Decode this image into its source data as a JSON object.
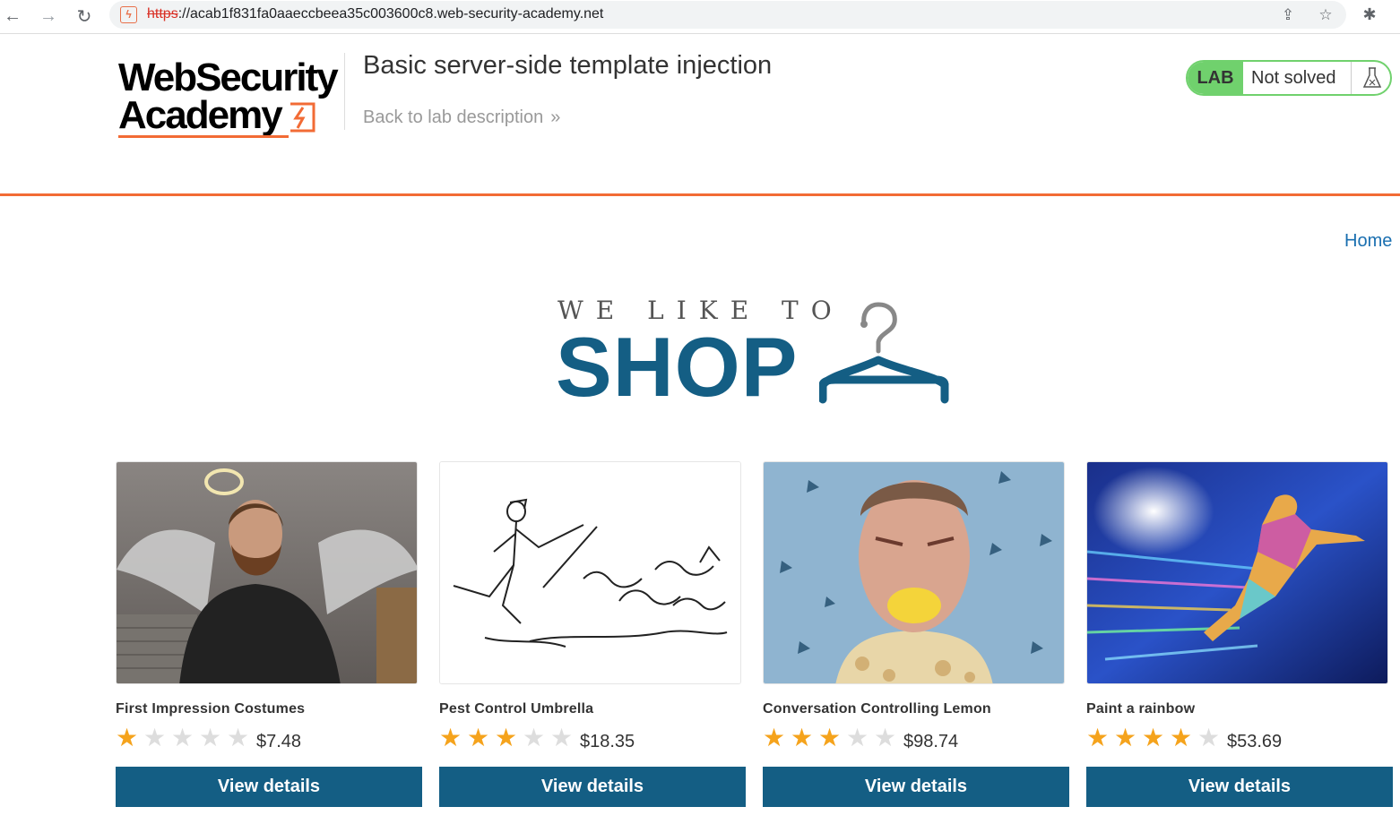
{
  "browser": {
    "url_protocol": "https",
    "url_rest": "://acab1f831fa0aaeccbeea35c003600c8.web-security-academy.net"
  },
  "lab": {
    "logo_line1": "WebSecurity",
    "logo_line2": "Academy",
    "title": "Basic server-side template injection",
    "back_link": "Back to lab description",
    "back_chevron": "»",
    "badge": "LAB",
    "status": "Not solved"
  },
  "nav": {
    "home": "Home"
  },
  "banner": {
    "tagline": "WE LIKE TO",
    "shop": "SHOP"
  },
  "products": [
    {
      "name": "First Impression Costumes",
      "rating": 1,
      "price": "$7.48",
      "button": "View details"
    },
    {
      "name": "Pest Control Umbrella",
      "rating": 3,
      "price": "$18.35",
      "button": "View details"
    },
    {
      "name": "Conversation Controlling Lemon",
      "rating": 3,
      "price": "$98.74",
      "button": "View details"
    },
    {
      "name": "Paint a rainbow",
      "rating": 4,
      "price": "$53.69",
      "button": "View details"
    }
  ],
  "colors": {
    "accent": "#f26b35",
    "primary": "#145e84",
    "lab_green": "#70d16d",
    "star": "#f5a31c"
  }
}
